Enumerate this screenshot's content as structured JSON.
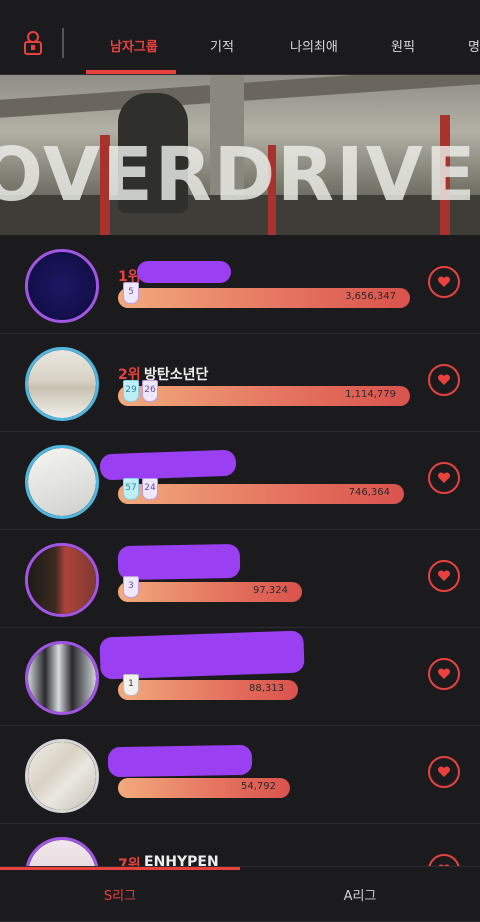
{
  "tabs": [
    {
      "label": "남자그룹",
      "active": true
    },
    {
      "label": "기적",
      "active": false
    },
    {
      "label": "나의최애",
      "active": false
    },
    {
      "label": "원픽",
      "active": false
    },
    {
      "label": "명",
      "active": false
    }
  ],
  "banner": {
    "text": "OVERDRIVE"
  },
  "accent_color": "#e8423f",
  "ranking": [
    {
      "rank": "1위",
      "name": "",
      "value": "3,656,347",
      "badges": [
        "5"
      ],
      "bar_fraction": 1.0
    },
    {
      "rank": "2위",
      "name": "방탄소년단",
      "value": "1,114,779",
      "badges": [
        "29",
        "26"
      ],
      "bar_fraction": 1.0
    },
    {
      "rank": "",
      "name": "",
      "value": "746,364",
      "badges": [
        "57",
        "24"
      ],
      "bar_fraction": 0.98
    },
    {
      "rank": "",
      "name": "",
      "value": "97,324",
      "badges": [
        "3"
      ],
      "bar_fraction": 0.65
    },
    {
      "rank": "",
      "name": "",
      "value": "88,313",
      "badges": [
        "1"
      ],
      "bar_fraction": 0.62
    },
    {
      "rank": "",
      "name": "",
      "value": "54,792",
      "badges": [],
      "bar_fraction": 0.6
    },
    {
      "rank": "7위",
      "name": "ENHYPEN"
    }
  ],
  "leagues": [
    {
      "label": "S리그",
      "active": true
    },
    {
      "label": "A리그",
      "active": false
    }
  ],
  "icons": {
    "logo": "trophy-lock-logo-icon",
    "vote": "heart-icon"
  }
}
